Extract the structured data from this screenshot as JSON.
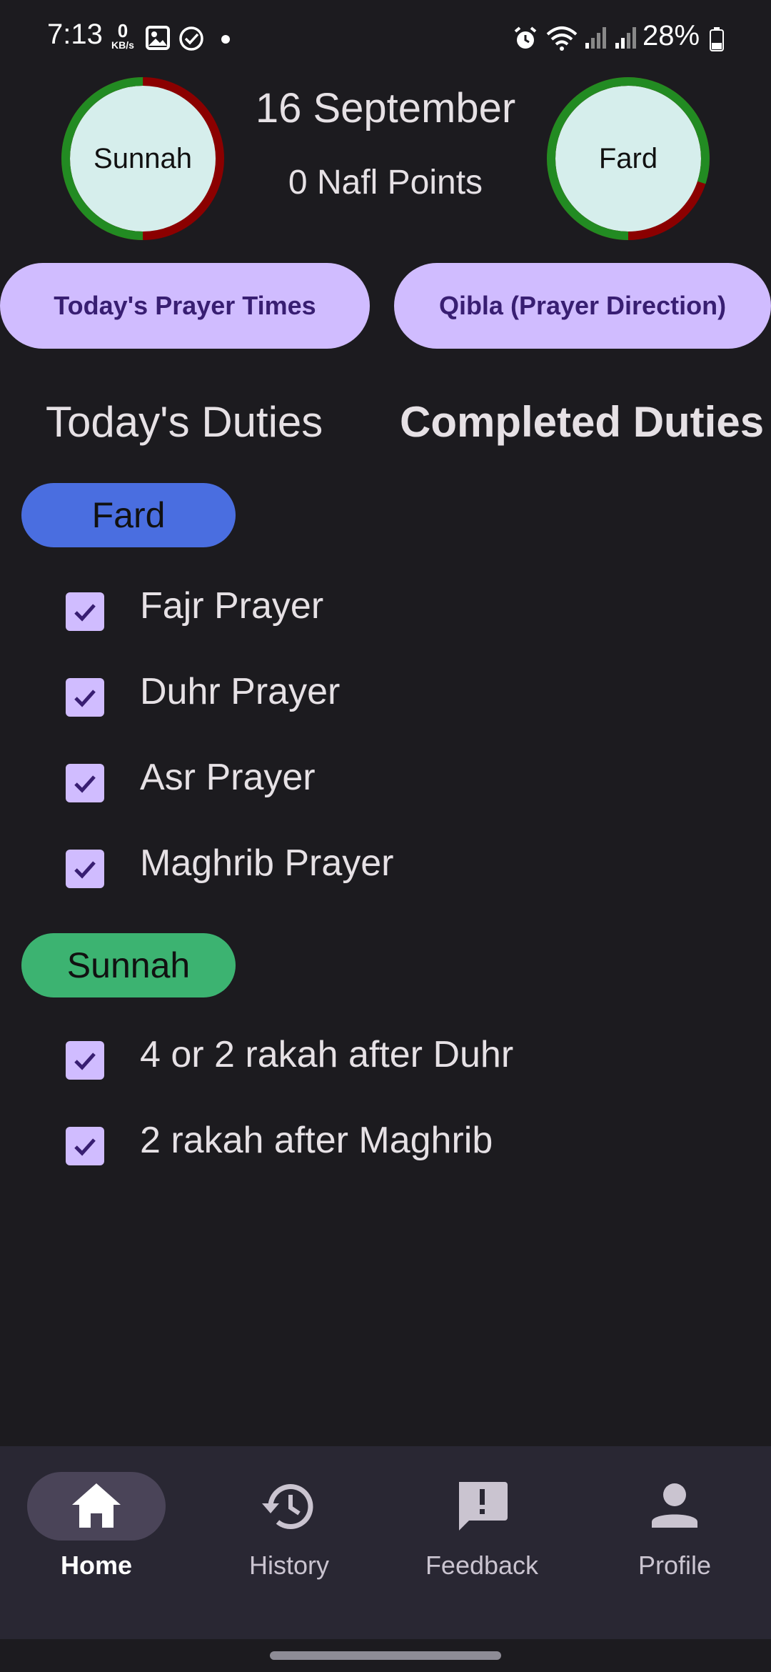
{
  "status_bar": {
    "time": "7:13",
    "net_speed_value": "0",
    "net_speed_unit": "KB/s",
    "battery": "28%"
  },
  "header": {
    "left_circle_label": "Sunnah",
    "right_circle_label": "Fard",
    "date": "16 September",
    "points": "0 Nafl Points",
    "left_circle_progress": 0.5,
    "right_circle_progress": 0.8
  },
  "buttons": {
    "prayer_times": "Today's Prayer Times",
    "qibla": "Qibla (Prayer Direction)"
  },
  "tabs": {
    "today": "Today's Duties",
    "completed": "Completed Duties"
  },
  "sections": {
    "fard": {
      "label": "Fard",
      "color": "#4a6ee0",
      "items": [
        "Fajr Prayer",
        "Duhr Prayer",
        "Asr Prayer",
        "Maghrib Prayer"
      ]
    },
    "sunnah": {
      "label": "Sunnah",
      "color": "#3cb371",
      "items": [
        "4 or 2 rakah after Duhr",
        "2 rakah after Maghrib"
      ]
    }
  },
  "bottom_nav": {
    "items": [
      {
        "label": "Home",
        "icon": "home-icon",
        "active": true
      },
      {
        "label": "History",
        "icon": "history-icon",
        "active": false
      },
      {
        "label": "Feedback",
        "icon": "feedback-icon",
        "active": false
      },
      {
        "label": "Profile",
        "icon": "person-icon",
        "active": false
      }
    ]
  },
  "colors": {
    "ring_complete": "#228b22",
    "ring_incomplete": "#8b0000",
    "accent": "#d0bcff"
  }
}
